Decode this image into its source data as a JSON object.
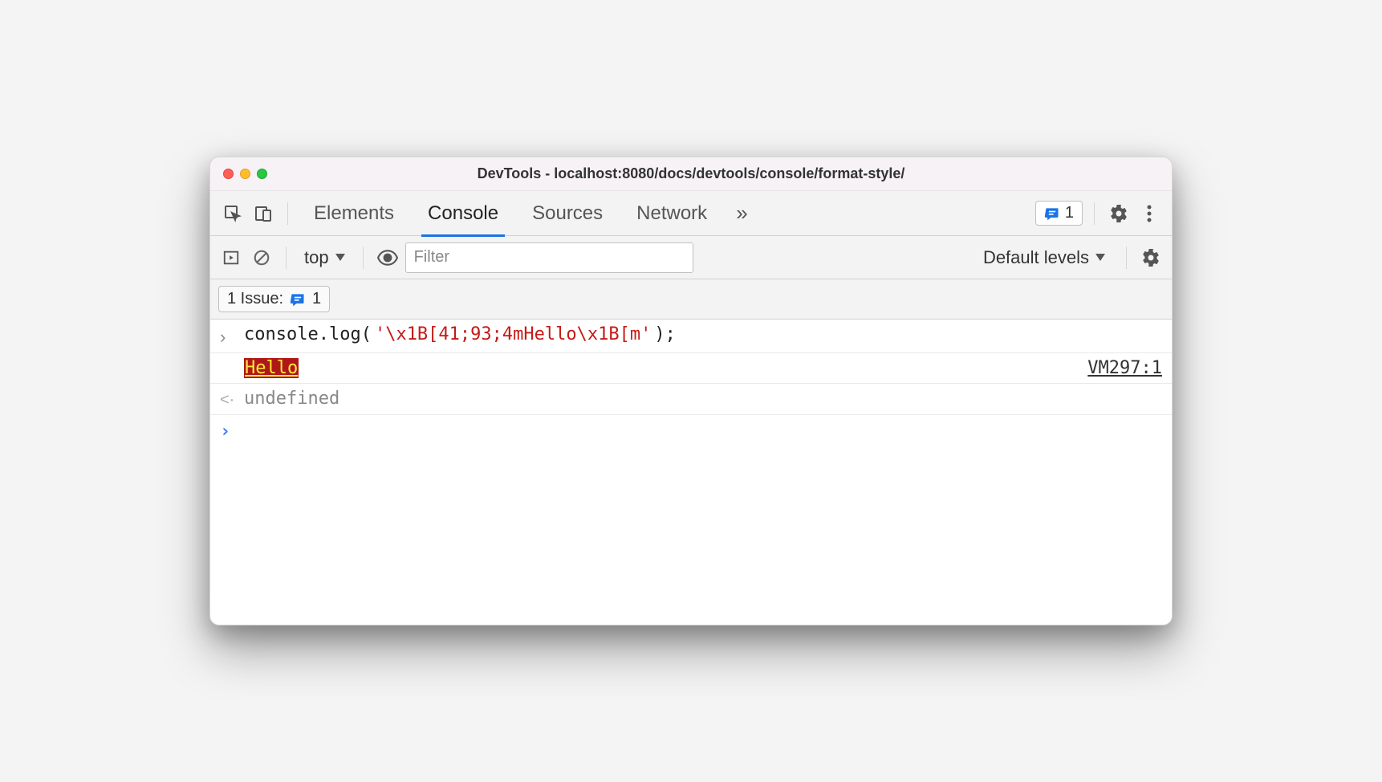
{
  "window": {
    "title": "DevTools - localhost:8080/docs/devtools/console/format-style/"
  },
  "tabs": {
    "items": [
      "Elements",
      "Console",
      "Sources",
      "Network"
    ],
    "active": "Console",
    "overflow_icon": "»"
  },
  "top_right": {
    "issues_badge_count": "1"
  },
  "toolbar": {
    "context_label": "top",
    "filter_placeholder": "Filter",
    "levels_label": "Default levels"
  },
  "issues_row": {
    "label": "1 Issue:",
    "count": "1"
  },
  "console": {
    "input_line": {
      "prefix": "console.log(",
      "string": "'\\x1B[41;93;4mHello\\x1B[m'",
      "suffix": ");"
    },
    "output_line": {
      "text": "Hello",
      "source": "VM297:1"
    },
    "return_line": {
      "text": "undefined"
    }
  }
}
